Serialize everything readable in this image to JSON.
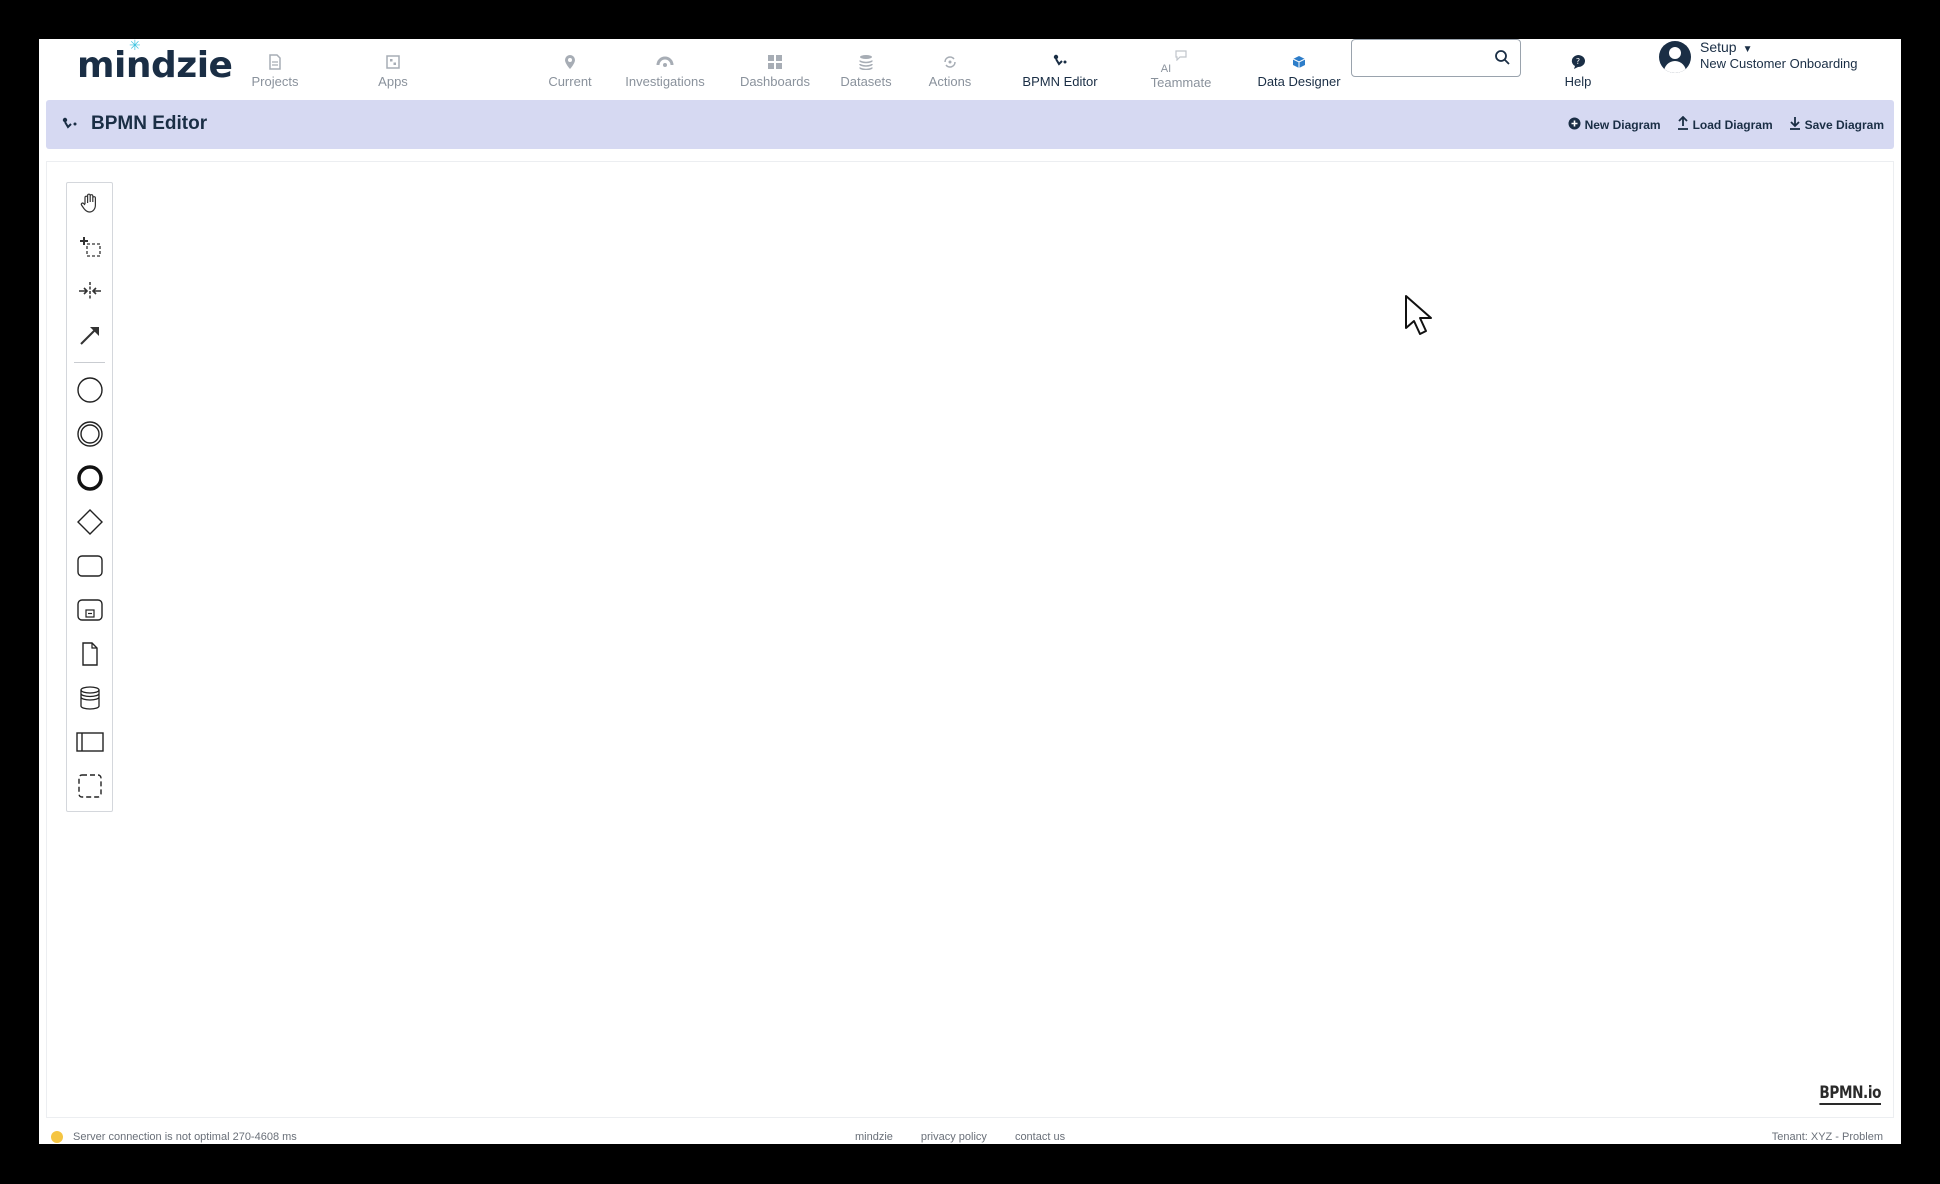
{
  "app": {
    "logo": "mindzie"
  },
  "nav": {
    "items": [
      {
        "label": "Projects",
        "icon": "document-icon"
      },
      {
        "label": "Apps",
        "icon": "apps-icon"
      },
      {
        "label": "Current",
        "icon": "location-pin-icon"
      },
      {
        "label": "Investigations",
        "icon": "investigation-icon"
      },
      {
        "label": "Dashboards",
        "icon": "dashboard-grid-icon"
      },
      {
        "label": "Datasets",
        "icon": "database-icon"
      },
      {
        "label": "Actions",
        "icon": "actions-icon"
      },
      {
        "label": "BPMN Editor",
        "icon": "bpmn-icon",
        "active": true
      },
      {
        "label_line1": "AI",
        "label_line2": "Teammate",
        "icon": "chat-bubble-icon"
      },
      {
        "label": "Data Designer",
        "icon": "cube-icon"
      }
    ],
    "search_placeholder": "",
    "help_label": "Help",
    "user": {
      "name": "Setup",
      "project": "New Customer Onboarding"
    }
  },
  "editor": {
    "title": "BPMN Editor",
    "actions": [
      {
        "label": "New Diagram",
        "icon": "plus-circle-icon"
      },
      {
        "label": "Load Diagram",
        "icon": "upload-icon"
      },
      {
        "label": "Save Diagram",
        "icon": "download-icon"
      }
    ],
    "palette": [
      {
        "tool": "hand-tool",
        "icon": "hand-icon"
      },
      {
        "tool": "lasso-tool",
        "icon": "lasso-icon"
      },
      {
        "tool": "space-tool",
        "icon": "space-icon"
      },
      {
        "tool": "global-connect-tool",
        "icon": "arrow-icon"
      },
      {
        "tool": "start-event",
        "icon": "start-event-icon"
      },
      {
        "tool": "intermediate-event",
        "icon": "intermediate-event-icon"
      },
      {
        "tool": "end-event",
        "icon": "end-event-icon"
      },
      {
        "tool": "gateway",
        "icon": "gateway-icon"
      },
      {
        "tool": "task",
        "icon": "task-icon"
      },
      {
        "tool": "subprocess",
        "icon": "subprocess-icon"
      },
      {
        "tool": "data-object",
        "icon": "data-object-icon"
      },
      {
        "tool": "data-store",
        "icon": "data-store-icon"
      },
      {
        "tool": "pool",
        "icon": "pool-icon"
      },
      {
        "tool": "group",
        "icon": "group-icon"
      }
    ],
    "watermark": "BPMN.io"
  },
  "footer": {
    "status": "Server connection is not optimal 270-4608 ms",
    "links": [
      "mindzie",
      "privacy policy",
      "contact us"
    ],
    "tenant": "Tenant: XYZ - Problem"
  },
  "colors": {
    "brand_dark": "#1a2e45",
    "header_bar": "#d6d9f2",
    "nav_inactive": "#8a929c",
    "logo_accent": "#3ec3e0"
  }
}
